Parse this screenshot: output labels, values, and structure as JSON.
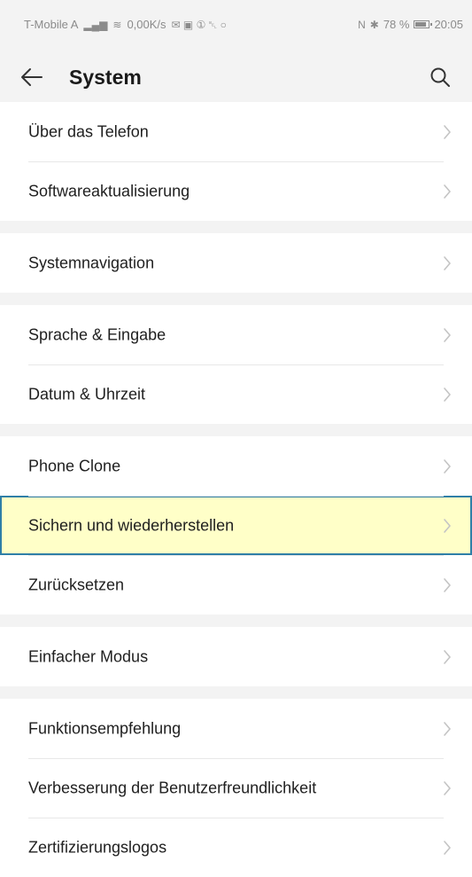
{
  "status_bar": {
    "carrier": "T-Mobile A",
    "signal": "▂▄▆",
    "wifi": "≋",
    "speed": "0,00K/s",
    "notif_icons": "✉ ▣ ① ␇ ○",
    "nfc": "N",
    "bluetooth": "✱",
    "battery": "78 %",
    "time": "20:05"
  },
  "appbar": {
    "title": "System"
  },
  "groups": [
    [
      "Über das Telefon",
      "Softwareaktualisierung"
    ],
    [
      "Systemnavigation"
    ],
    [
      "Sprache & Eingabe",
      "Datum & Uhrzeit"
    ],
    [
      "Phone Clone",
      "Sichern und wiederherstellen",
      "Zurücksetzen"
    ],
    [
      "Einfacher Modus"
    ],
    [
      "Funktionsempfehlung",
      "Verbesserung der Benutzerfreundlichkeit",
      "Zertifizierungslogos"
    ]
  ],
  "highlighted_item": "Sichern und wiederherstellen",
  "colors": {
    "background": "#f3f3f3",
    "row": "#ffffff",
    "highlight_fill": "#ffffc8",
    "highlight_border": "#2f7fa7",
    "chevron": "#c4c4c4"
  },
  "icons": {
    "back": "arrow-left-icon",
    "search": "search-icon",
    "chevron": "chevron-right-icon"
  }
}
